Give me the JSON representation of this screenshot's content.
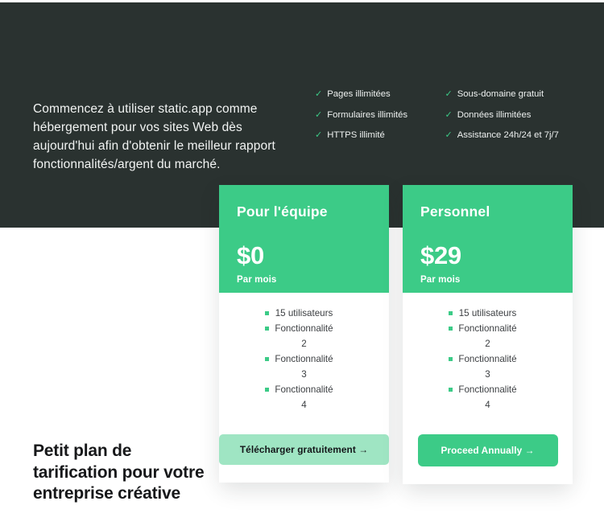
{
  "hero": {
    "lede": "Commencez à utiliser static.app comme hébergement pour vos sites Web dès aujourd'hui afin d'obtenir le meilleur rapport fonctionnalités/argent du marché.",
    "check_icon": "check-icon",
    "features_left": [
      "Pages illimitées",
      "Formulaires illimités",
      "HTTPS illimité"
    ],
    "features_right": [
      "Sous-domaine gratuit",
      "Données illimitées",
      "Assistance 24h/24 et 7j/7"
    ]
  },
  "bottom_heading": "Petit plan de tarification pour votre entreprise créative",
  "cards": [
    {
      "title": "Pour l'équipe",
      "price": "$0",
      "period": "Par mois",
      "bullet_icon": "square-bullet-icon",
      "features": [
        "15 utilisateurs",
        "Fonctionnalité 2",
        "Fonctionnalité 3",
        "Fonctionnalité 4"
      ],
      "cta_label": "Télécharger gratuitement →"
    },
    {
      "title": "Personnel",
      "price": "$29",
      "period": "Par mois",
      "bullet_icon": "square-bullet-icon",
      "features": [
        "15 utilisateurs",
        "Fonctionnalité 2",
        "Fonctionnalité 3",
        "Fonctionnalité 4"
      ],
      "cta_label": "Proceed Annually →"
    }
  ],
  "colors": {
    "dark_background": "#2a3230",
    "accent_green": "#3ccb87",
    "soft_green": "#9fe5c3",
    "page_background": "#ffffff",
    "body_text": "#3c3f42",
    "heading_text": "#17181a"
  }
}
